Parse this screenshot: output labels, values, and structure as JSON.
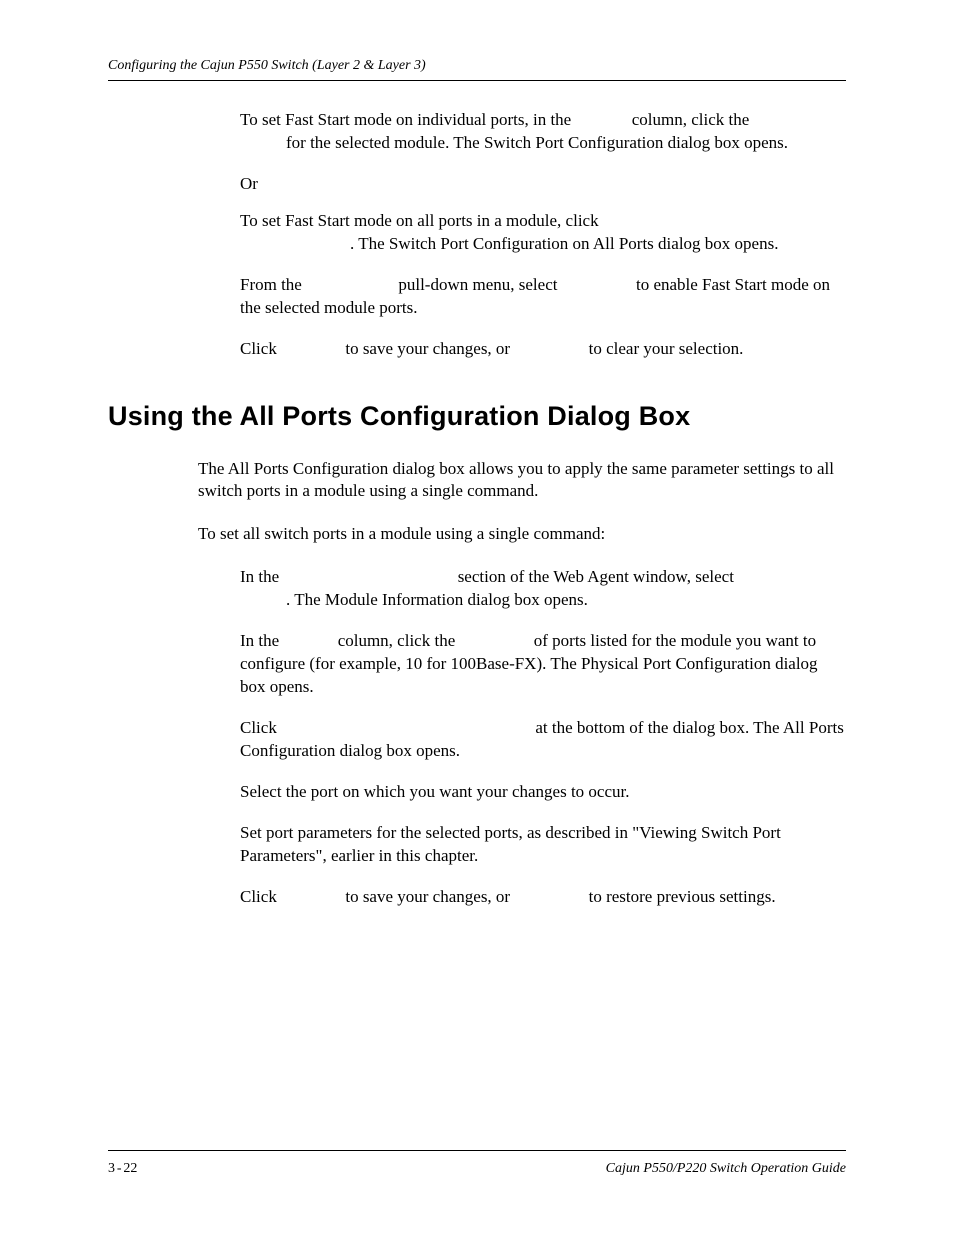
{
  "header": {
    "running": "Configuring the Cajun P550 Switch (Layer 2 & Layer 3)"
  },
  "block1": {
    "p1a": "To set Fast Start mode on individual ports, in the ",
    "p1b": " column, click the ",
    "p1c": "for the selected module. The Switch Port Configuration dialog box opens.",
    "or": "Or",
    "p2a": "To set Fast Start mode on all ports in a module, click ",
    "p2b": ". The Switch Port Configuration on All Ports dialog box opens.",
    "p3a": "From the ",
    "p3b": " pull-down menu, select ",
    "p3c": " to enable Fast Start mode on the selected module ports.",
    "p4a": "Click ",
    "p4b": " to save your changes, or ",
    "p4c": " to clear your selection."
  },
  "heading": "Using the All Ports Configuration Dialog Box",
  "intro": {
    "p1": "The All Ports Configuration dialog box allows you to apply the same parameter settings to all switch ports in a module using a single command.",
    "p2": "To set all switch ports in a module using a single command:"
  },
  "steps": {
    "s1a": "In the ",
    "s1b": " section of the Web Agent window, select ",
    "s1c": ". The Module Information dialog box opens.",
    "s2a": "In the ",
    "s2b": " column, click the ",
    "s2c": " of ports listed for the module you want to configure (for example, 10 for 100Base-FX). The Physical Port Configuration dialog box opens.",
    "s3a": "Click ",
    "s3b": " at the bottom of the dialog box. The All Ports Configuration dialog box opens.",
    "s4": "Select the port on which you want your changes to occur.",
    "s5": "Set port parameters for the selected ports, as described in \"Viewing Switch Port Parameters\", earlier in this chapter.",
    "s6a": "Click ",
    "s6b": " to save your changes, or ",
    "s6c": " to restore previous settings."
  },
  "footer": {
    "page_chapter": "3",
    "page_num": "22",
    "guide": "Cajun P550/P220 Switch Operation Guide"
  }
}
